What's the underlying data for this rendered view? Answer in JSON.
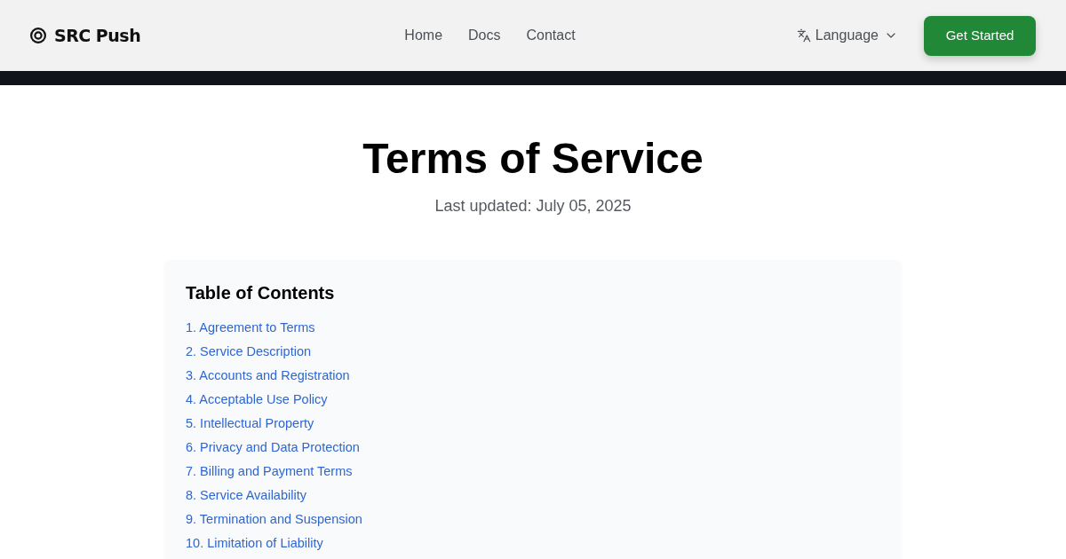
{
  "header": {
    "logo": "SRC Push",
    "nav": [
      "Home",
      "Docs",
      "Contact"
    ],
    "language": "Language",
    "cta": "Get Started"
  },
  "page": {
    "title": "Terms of Service",
    "updated": "Last updated: July 05, 2025"
  },
  "toc": {
    "title": "Table of Contents",
    "items": [
      "1. Agreement to Terms",
      "2. Service Description",
      "3. Accounts and Registration",
      "4. Acceptable Use Policy",
      "5. Intellectual Property",
      "6. Privacy and Data Protection",
      "7. Billing and Payment Terms",
      "8. Service Availability",
      "9. Termination and Suspension",
      "10. Limitation of Liability"
    ]
  }
}
